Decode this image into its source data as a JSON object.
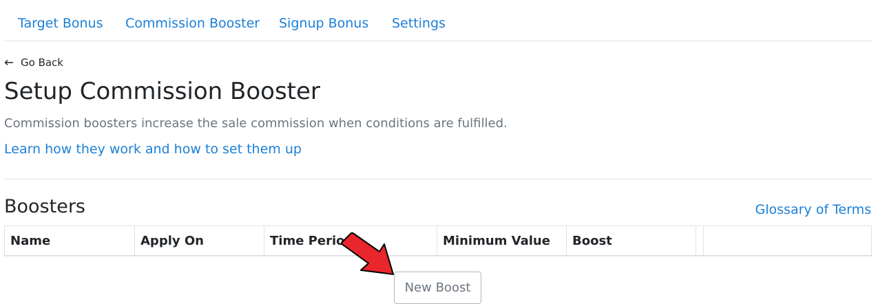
{
  "nav": {
    "tabs": [
      {
        "label": "Target Bonus"
      },
      {
        "label": "Commission Booster"
      },
      {
        "label": "Signup Bonus"
      },
      {
        "label": "Settings"
      }
    ]
  },
  "back": {
    "icon": "arrow-left-icon",
    "label": "Go Back"
  },
  "page": {
    "title": "Setup Commission Booster",
    "description": "Commission boosters increase the sale commission when conditions are fulfilled.",
    "learn_link": "Learn how they work and how to set them up"
  },
  "boosters": {
    "heading": "Boosters",
    "glossary_link": "Glossary of Terms",
    "columns": [
      "Name",
      "Apply On",
      "Time Period",
      "Minimum Value",
      "Boost"
    ],
    "rows": [],
    "new_button": "New Boost"
  },
  "annotation": {
    "icon": "red-arrow-icon",
    "color": "#e8262b"
  },
  "colors": {
    "link": "#1a7fd6",
    "muted": "#6c757d",
    "border": "#dee2e6"
  }
}
